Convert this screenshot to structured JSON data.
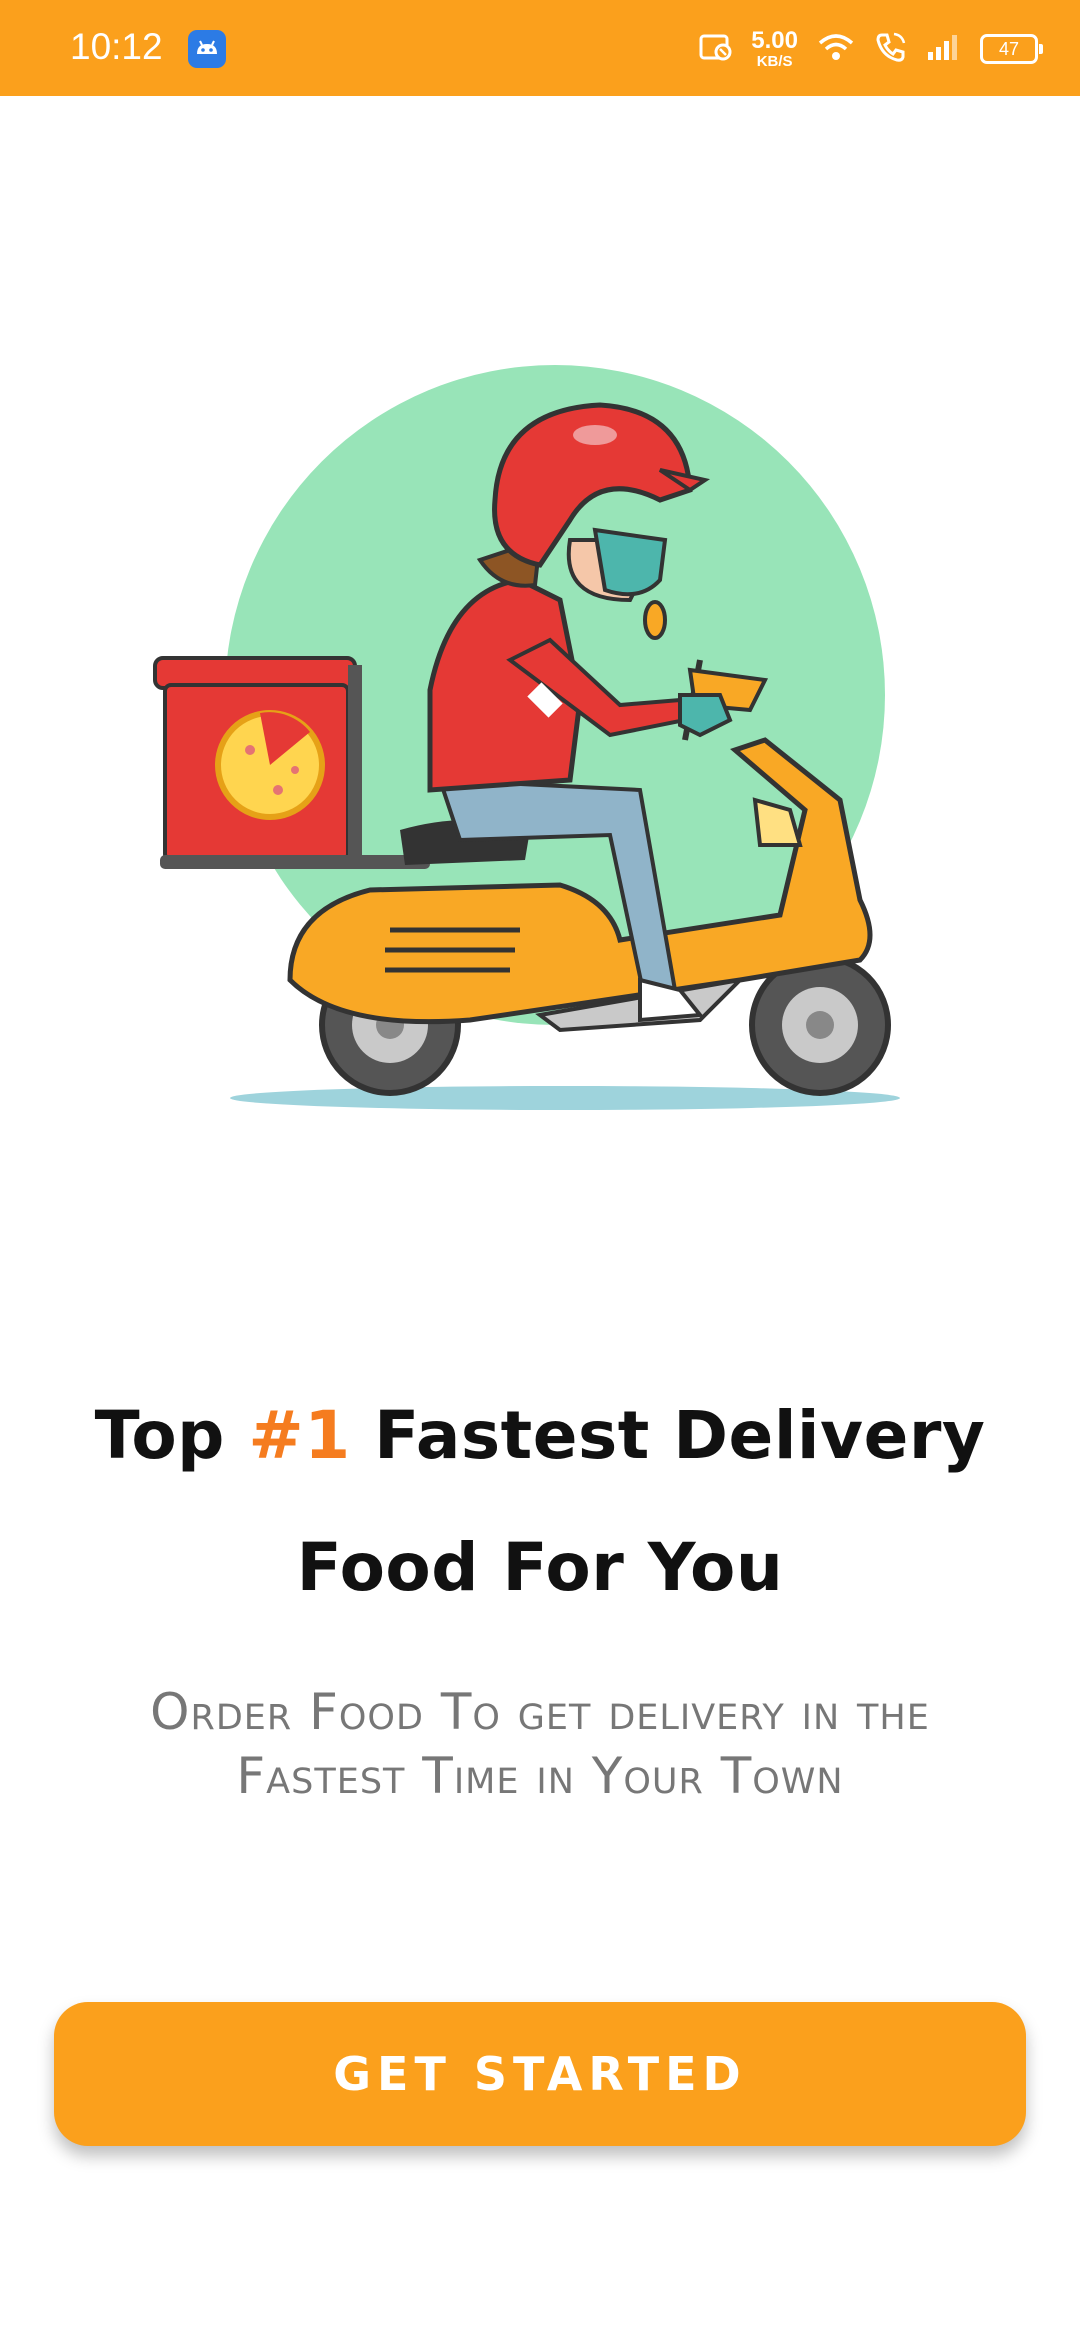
{
  "status_bar": {
    "time": "10:12",
    "net_speed_value": "5.00",
    "net_speed_unit": "KB/S",
    "battery_level": "47",
    "icons": [
      "android-app-icon",
      "screen-record-icon",
      "wifi-icon",
      "volte-call-icon",
      "signal-icon",
      "battery-icon"
    ]
  },
  "hero": {
    "illustration": "delivery-rider-on-scooter-illustration"
  },
  "headline": {
    "line1_prefix": "Top ",
    "accent": "#1",
    "line1_suffix": " Fastest Delivery",
    "line2": "Food For You"
  },
  "subtitle": {
    "line1": "Order Food To get delivery in the",
    "line2": "Fastest Time in Your Town"
  },
  "cta": {
    "label": "GET STARTED"
  },
  "colors": {
    "brand": "#FBA01C",
    "accent": "#F57C1F",
    "headline": "#111111",
    "subtitle": "#777777"
  }
}
